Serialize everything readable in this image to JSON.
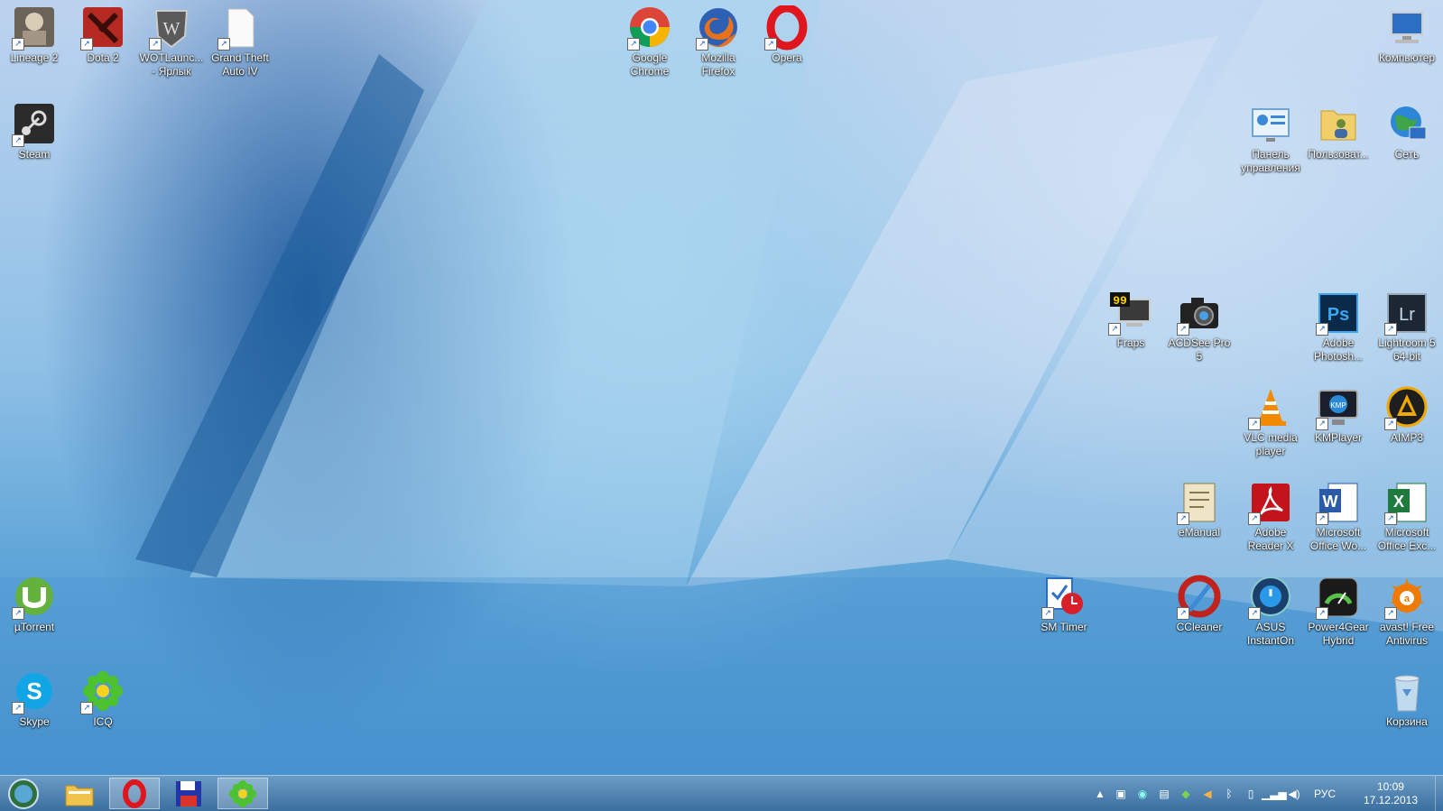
{
  "desktop_icons": [
    {
      "label": "Lineage 2",
      "icon": "lineage2-icon"
    },
    {
      "label": "Dota 2",
      "icon": "dota2-icon"
    },
    {
      "label": "WOTLaunc... - Ярлык",
      "icon": "wot-launcher-icon"
    },
    {
      "label": "Grand Theft Auto IV",
      "icon": "blank-document-icon"
    },
    {
      "label": "Google Chrome",
      "icon": "chrome-icon"
    },
    {
      "label": "Mozilla Firefox",
      "icon": "firefox-icon"
    },
    {
      "label": "Opera",
      "icon": "opera-icon"
    },
    {
      "label": "Компьютер",
      "icon": "computer-icon"
    },
    {
      "label": "Steam",
      "icon": "steam-icon"
    },
    {
      "label": "Панель управления",
      "icon": "control-panel-icon"
    },
    {
      "label": "Пользоват...",
      "icon": "user-folder-icon"
    },
    {
      "label": "Сеть",
      "icon": "network-icon"
    },
    {
      "label": "Fraps",
      "icon": "fraps-icon"
    },
    {
      "label": "ACDSee Pro 5",
      "icon": "camera-icon"
    },
    {
      "label": "Adobe Photosh...",
      "icon": "photoshop-icon"
    },
    {
      "label": "Lightroom 5 64-bit",
      "icon": "lightroom-icon"
    },
    {
      "label": "VLC media player",
      "icon": "vlc-icon"
    },
    {
      "label": "KMPlayer",
      "icon": "kmplayer-icon"
    },
    {
      "label": "AIMP3",
      "icon": "aimp-icon"
    },
    {
      "label": "eManual",
      "icon": "emanual-icon"
    },
    {
      "label": "Adobe Reader X",
      "icon": "adobe-reader-icon"
    },
    {
      "label": "Microsoft Office Wo...",
      "icon": "word-icon"
    },
    {
      "label": "Microsoft Office Exc...",
      "icon": "excel-icon"
    },
    {
      "label": "µTorrent",
      "icon": "utorrent-icon"
    },
    {
      "label": "SM Timer",
      "icon": "timer-icon"
    },
    {
      "label": "CCleaner",
      "icon": "ccleaner-icon"
    },
    {
      "label": "ASUS InstantOn",
      "icon": "asus-instanton-icon"
    },
    {
      "label": "Power4Gear Hybrid",
      "icon": "power4gear-icon"
    },
    {
      "label": "avast! Free Antivirus",
      "icon": "avast-icon"
    },
    {
      "label": "Skype",
      "icon": "skype-icon"
    },
    {
      "label": "ICQ",
      "icon": "icq-icon"
    },
    {
      "label": "Корзина",
      "icon": "recycle-bin-icon"
    }
  ],
  "taskbar": {
    "items": [
      {
        "icon": "start-orb-icon",
        "active": false
      },
      {
        "icon": "file-explorer-icon",
        "active": false
      },
      {
        "icon": "opera-icon",
        "active": true
      },
      {
        "icon": "floppy-disk-icon",
        "active": false
      },
      {
        "icon": "icq-icon",
        "active": true
      }
    ],
    "tray": {
      "language": "РУС",
      "time": "10:09",
      "date": "17.12.2013",
      "icons": [
        "show-hidden-icons-chevron-icon",
        "action-center-icon",
        "network-tray-icon",
        "display-tray-icon",
        "nvidia-tray-icon",
        "speaker-tray-icon",
        "bluetooth-icon",
        "battery-icon",
        "wifi-signal-icon",
        "volume-icon"
      ]
    }
  }
}
